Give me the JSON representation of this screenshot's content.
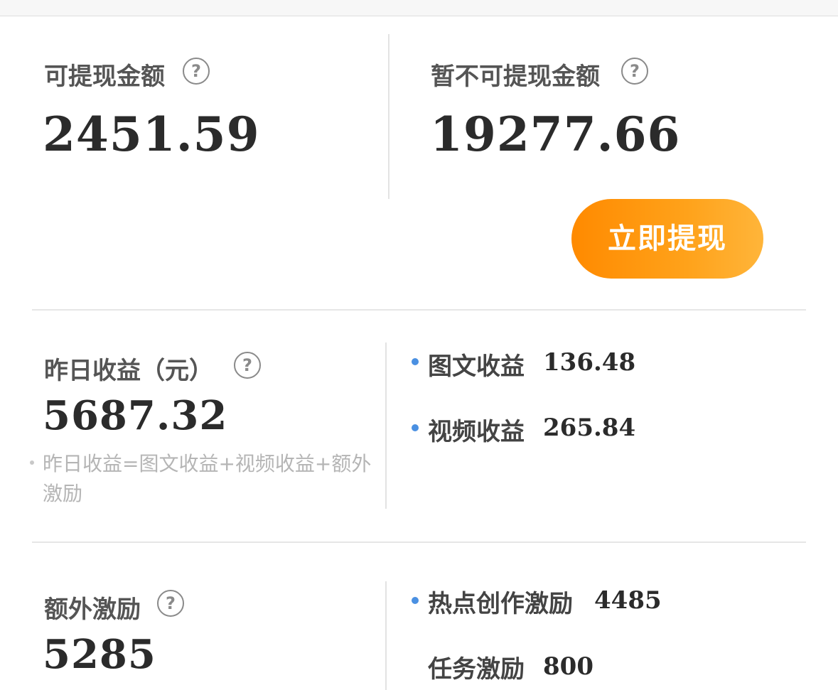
{
  "withdrawable": {
    "label": "可提现金额",
    "amount": "2451.59"
  },
  "not_withdrawable": {
    "label": "暂不可提现金额",
    "amount": "19277.66"
  },
  "withdraw_button": {
    "label": "立即提现"
  },
  "help_icon_glyph": "?",
  "yesterday": {
    "label": "昨日收益（元）",
    "amount": "5687.32",
    "note": "昨日收益=图文收益+视频收益+额外激励",
    "items": [
      {
        "label": "图文收益",
        "value": "136.48"
      },
      {
        "label": "视频收益",
        "value": "265.84"
      }
    ]
  },
  "extra": {
    "label": "额外激励",
    "amount": "5285",
    "items": [
      {
        "label": "热点创作激励",
        "value": "4485"
      },
      {
        "label": "任务激励",
        "value": "800"
      }
    ]
  },
  "colors": {
    "accent": "#ff8a00",
    "dot": "#4a90e2"
  },
  "icons": [
    "help-circle-icon",
    "bullet-dot-icon"
  ]
}
